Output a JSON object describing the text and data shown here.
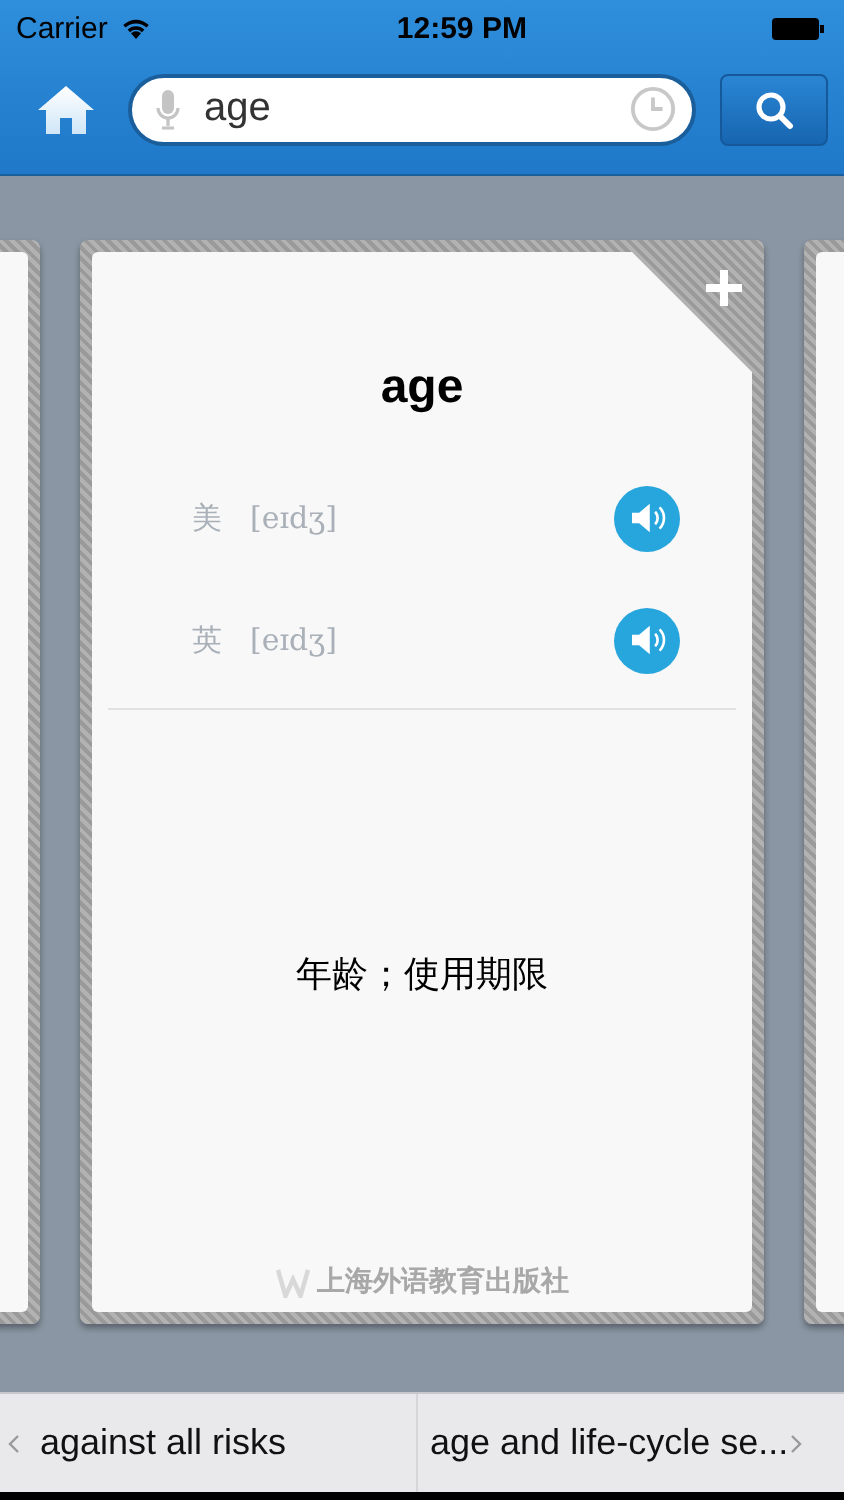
{
  "status_bar": {
    "carrier": "Carrier",
    "time": "12:59 PM"
  },
  "search": {
    "value": "age"
  },
  "card": {
    "word": "age",
    "pronunciations": [
      {
        "region": "美",
        "phonetic": "[eɪdʒ]"
      },
      {
        "region": "英",
        "phonetic": "[eɪdʒ]"
      }
    ],
    "definition": "年龄；使用期限",
    "publisher": "上海外语教育出版社"
  },
  "pager": {
    "previous": "against all risks",
    "next": "age and life-cycle se..."
  }
}
